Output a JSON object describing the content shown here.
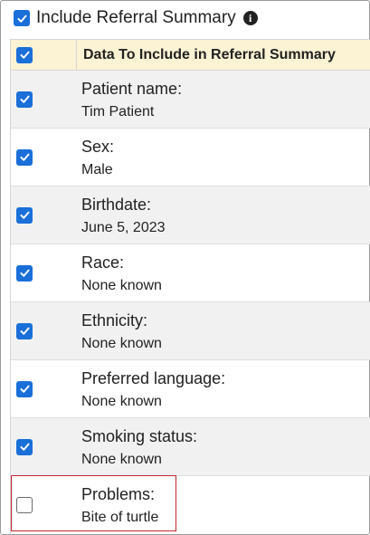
{
  "header": {
    "include_label": "Include Referral Summary",
    "include_checked": true,
    "info_icon": "info-circle-icon"
  },
  "table": {
    "column_title": "Data To Include in Referral Summary",
    "select_all_checked": true,
    "rows": [
      {
        "label": "Patient name:",
        "value": "Tim Patient",
        "checked": true
      },
      {
        "label": "Sex:",
        "value": "Male",
        "checked": true
      },
      {
        "label": "Birthdate:",
        "value": "June 5, 2023",
        "checked": true
      },
      {
        "label": "Race:",
        "value": "None known",
        "checked": true
      },
      {
        "label": "Ethnicity:",
        "value": "None known",
        "checked": true
      },
      {
        "label": "Preferred language:",
        "value": "None known",
        "checked": true
      },
      {
        "label": "Smoking status:",
        "value": "None known",
        "checked": true
      },
      {
        "label": "Problems:",
        "value": "Bite of turtle",
        "checked": false
      }
    ]
  },
  "colors": {
    "checkbox_checked": "#1a6fd8",
    "header_bg": "#fcf2d4",
    "highlight_border": "#c0272d"
  }
}
